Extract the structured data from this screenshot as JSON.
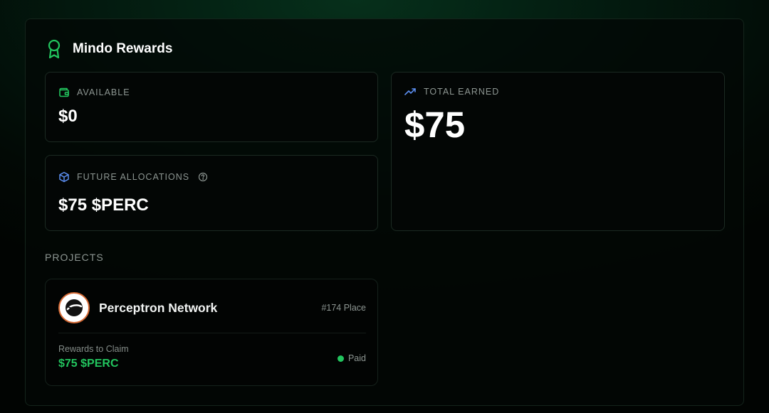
{
  "app": {
    "title": "Mindo Rewards",
    "icon": "award-ribbon-icon"
  },
  "colors": {
    "accent_green": "#22c55e",
    "accent_blue": "#5b8def",
    "panel_border": "#14241b"
  },
  "available": {
    "label": "AVAILABLE",
    "icon": "wallet-icon",
    "value": "$0"
  },
  "total_earned": {
    "label": "TOTAL EARNED",
    "icon": "trending-up-icon",
    "value": "$75"
  },
  "future_allocations": {
    "label": "FUTURE ALLOCATIONS",
    "icon": "cube-icon",
    "help_icon": "help-circle-icon",
    "value": "$75 $PERC"
  },
  "projects": {
    "heading": "PROJECTS",
    "items": [
      {
        "name": "Perceptron Network",
        "rank": "#174 Place",
        "rewards_label": "Rewards to Claim",
        "rewards_value": "$75 $PERC",
        "status": "Paid"
      }
    ]
  }
}
